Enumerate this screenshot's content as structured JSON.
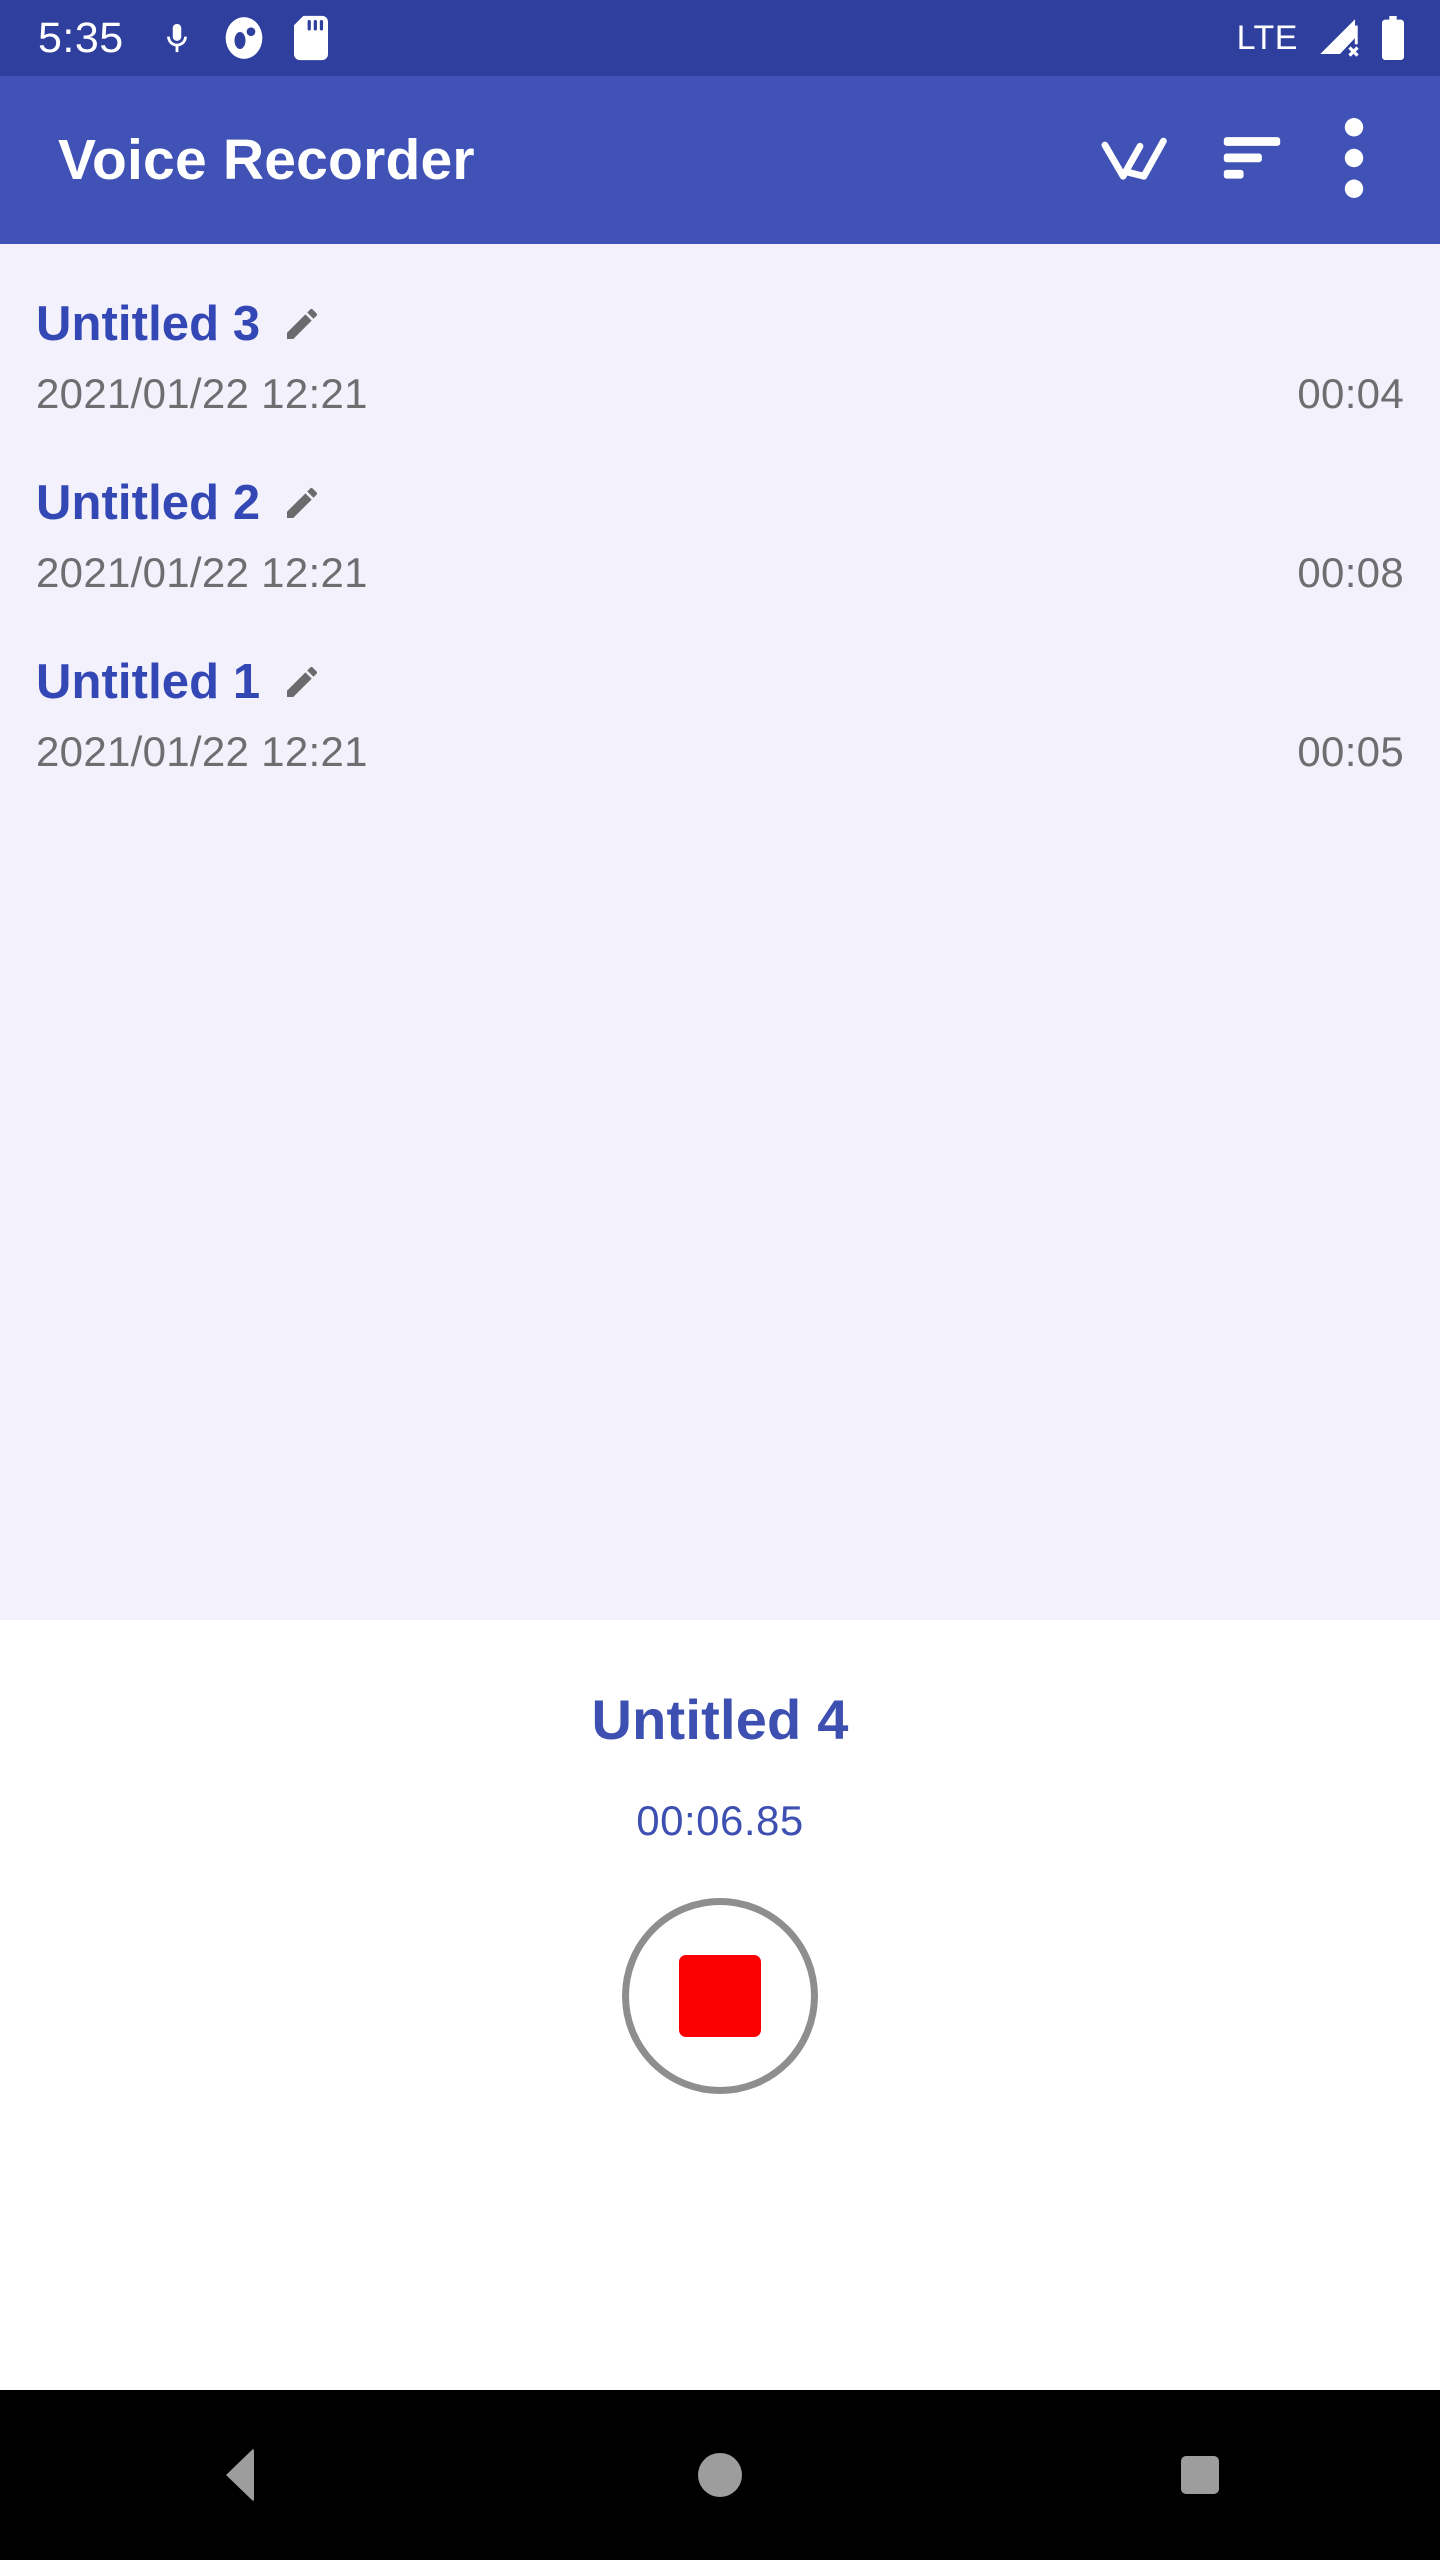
{
  "status_bar": {
    "clock": "5:35",
    "icons": [
      "microphone-icon",
      "circle-app-icon",
      "sd-card-icon"
    ],
    "network_label": "LTE",
    "signal_icon": "signal-no-service-icon",
    "battery_icon": "battery-full-icon",
    "background_color": "#2e3f9e"
  },
  "app_bar": {
    "title": "Voice Recorder",
    "background_color": "#4052b5",
    "actions": [
      {
        "name": "select-all-icon",
        "label": "Select all"
      },
      {
        "name": "sort-icon",
        "label": "Sort"
      },
      {
        "name": "overflow-menu-icon",
        "label": "More options"
      }
    ]
  },
  "recordings": {
    "background_color": "#f3f1fc",
    "title_color": "#3448b5",
    "items": [
      {
        "name": "Untitled 3",
        "date": "2021/01/22 12:21",
        "duration": "00:04"
      },
      {
        "name": "Untitled 2",
        "date": "2021/01/22 12:21",
        "duration": "00:08"
      },
      {
        "name": "Untitled 1",
        "date": "2021/01/22 12:21",
        "duration": "00:05"
      }
    ]
  },
  "record_panel": {
    "current_name": "Untitled 4",
    "timer": "00:06.85",
    "stop_button_label": "Stop recording",
    "stop_color": "#fb0000",
    "ring_color": "#8e8e8e",
    "background_color": "#ffffff"
  },
  "nav_bar": {
    "background_color": "#000000",
    "buttons": [
      {
        "name": "nav-back-button",
        "label": "Back"
      },
      {
        "name": "nav-home-button",
        "label": "Home"
      },
      {
        "name": "nav-recents-button",
        "label": "Recents"
      }
    ]
  }
}
